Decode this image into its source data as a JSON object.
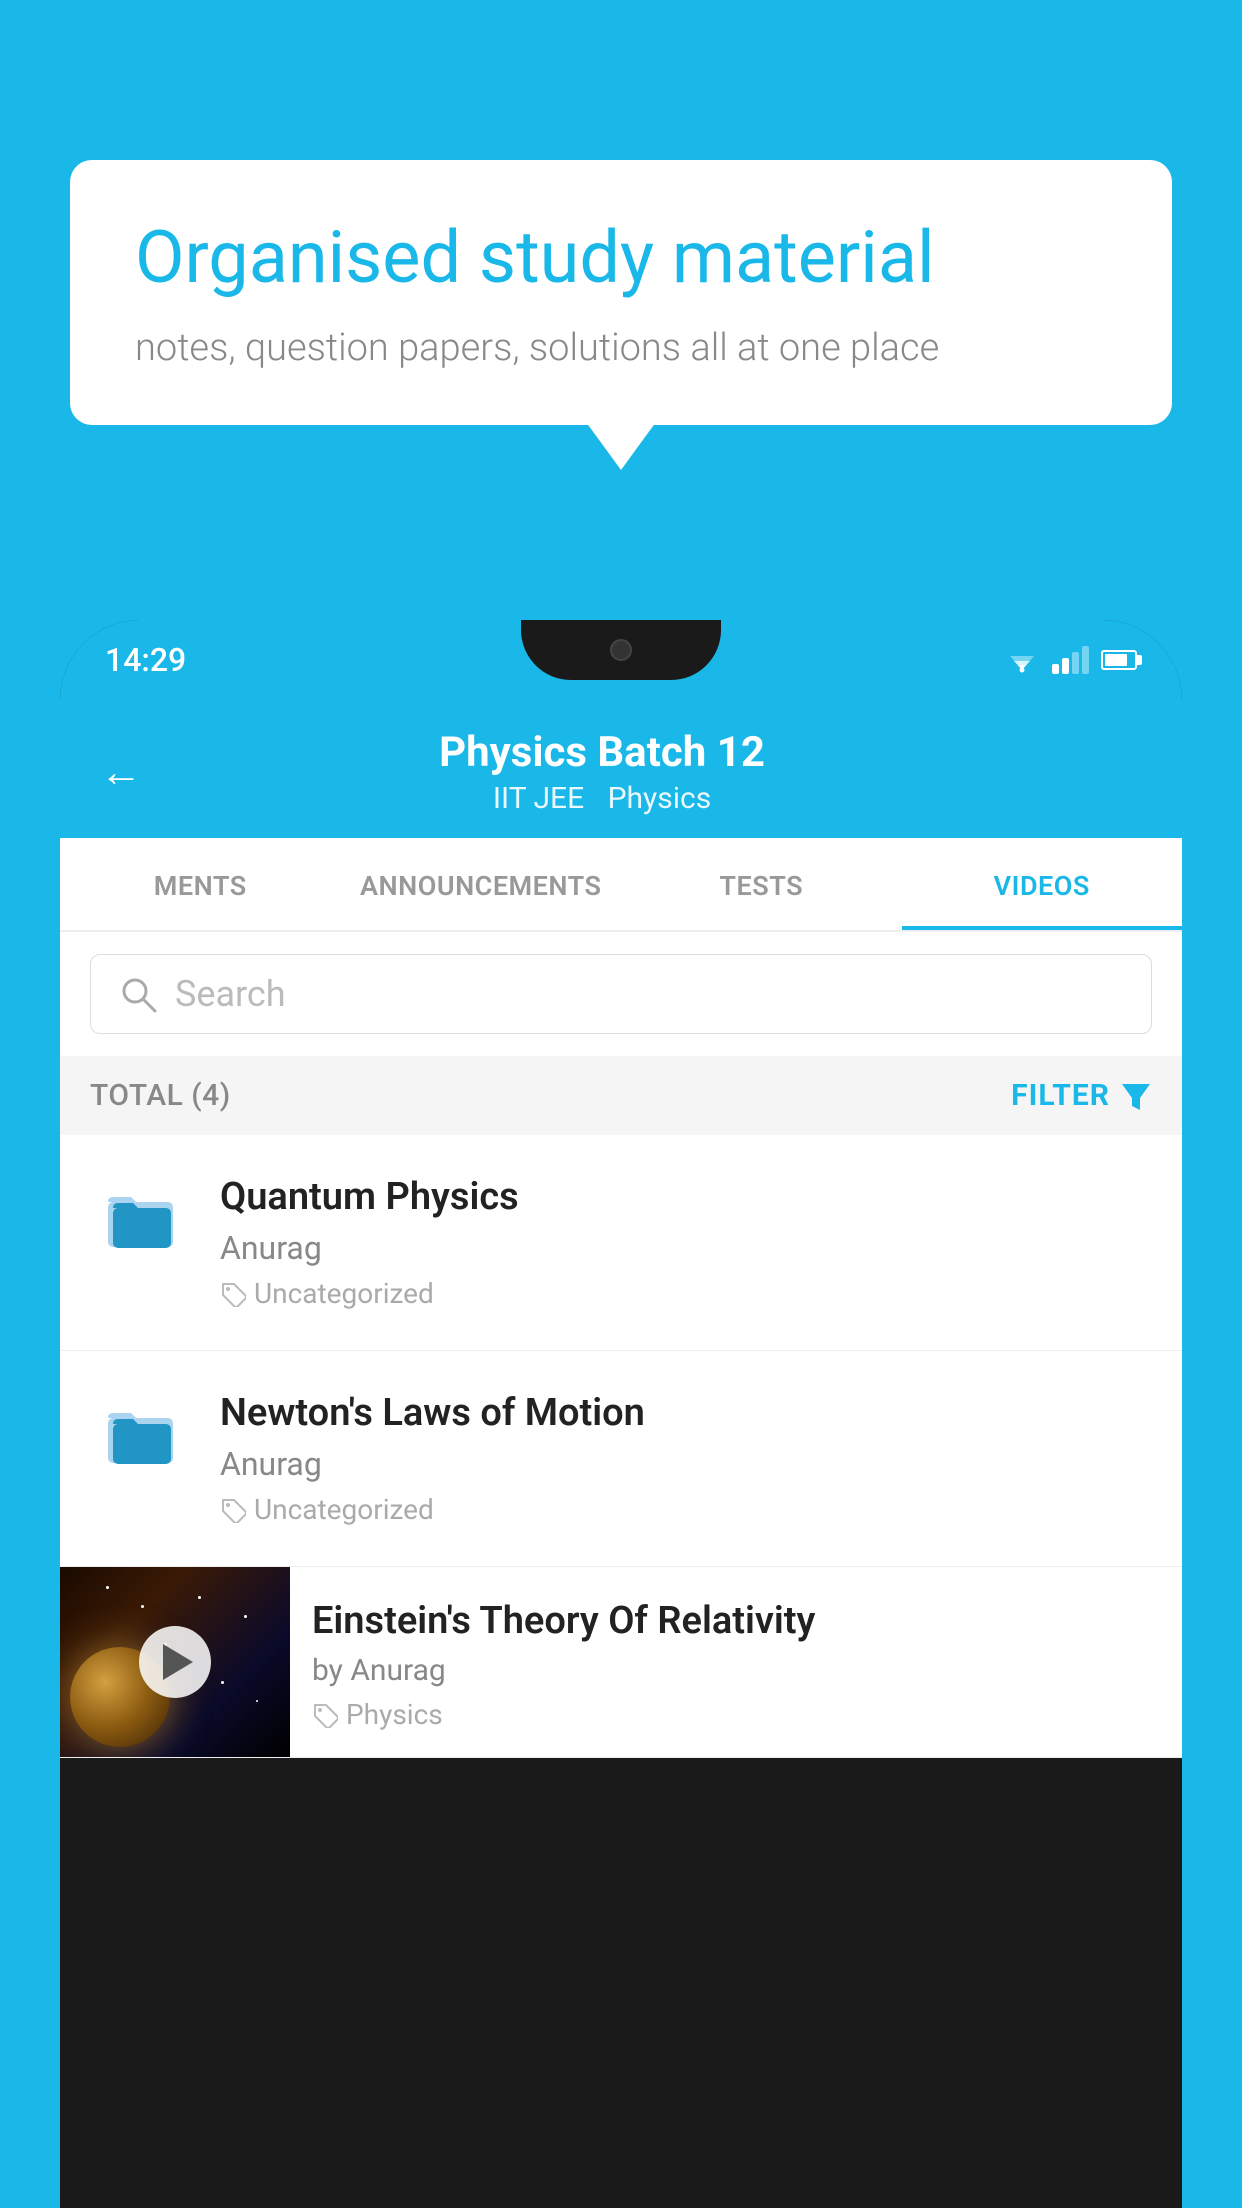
{
  "background_color": "#1ab8e8",
  "speech_bubble": {
    "title": "Organised study material",
    "subtitle": "notes, question papers, solutions all at one place"
  },
  "phone": {
    "status_bar": {
      "time": "14:29"
    },
    "header": {
      "back_label": "←",
      "title": "Physics Batch 12",
      "subtitle_part1": "IIT JEE",
      "subtitle_part2": "Physics"
    },
    "tabs": [
      {
        "label": "MENTS",
        "active": false
      },
      {
        "label": "ANNOUNCEMENTS",
        "active": false
      },
      {
        "label": "TESTS",
        "active": false
      },
      {
        "label": "VIDEOS",
        "active": true
      }
    ],
    "search": {
      "placeholder": "Search"
    },
    "filter_bar": {
      "total_label": "TOTAL (4)",
      "filter_label": "FILTER"
    },
    "video_items": [
      {
        "id": 1,
        "title": "Quantum Physics",
        "author": "Anurag",
        "tag": "Uncategorized",
        "has_thumbnail": false
      },
      {
        "id": 2,
        "title": "Newton's Laws of Motion",
        "author": "Anurag",
        "tag": "Uncategorized",
        "has_thumbnail": false
      },
      {
        "id": 3,
        "title": "Einstein's Theory Of Relativity",
        "author": "by Anurag",
        "tag": "Physics",
        "has_thumbnail": true
      }
    ]
  }
}
